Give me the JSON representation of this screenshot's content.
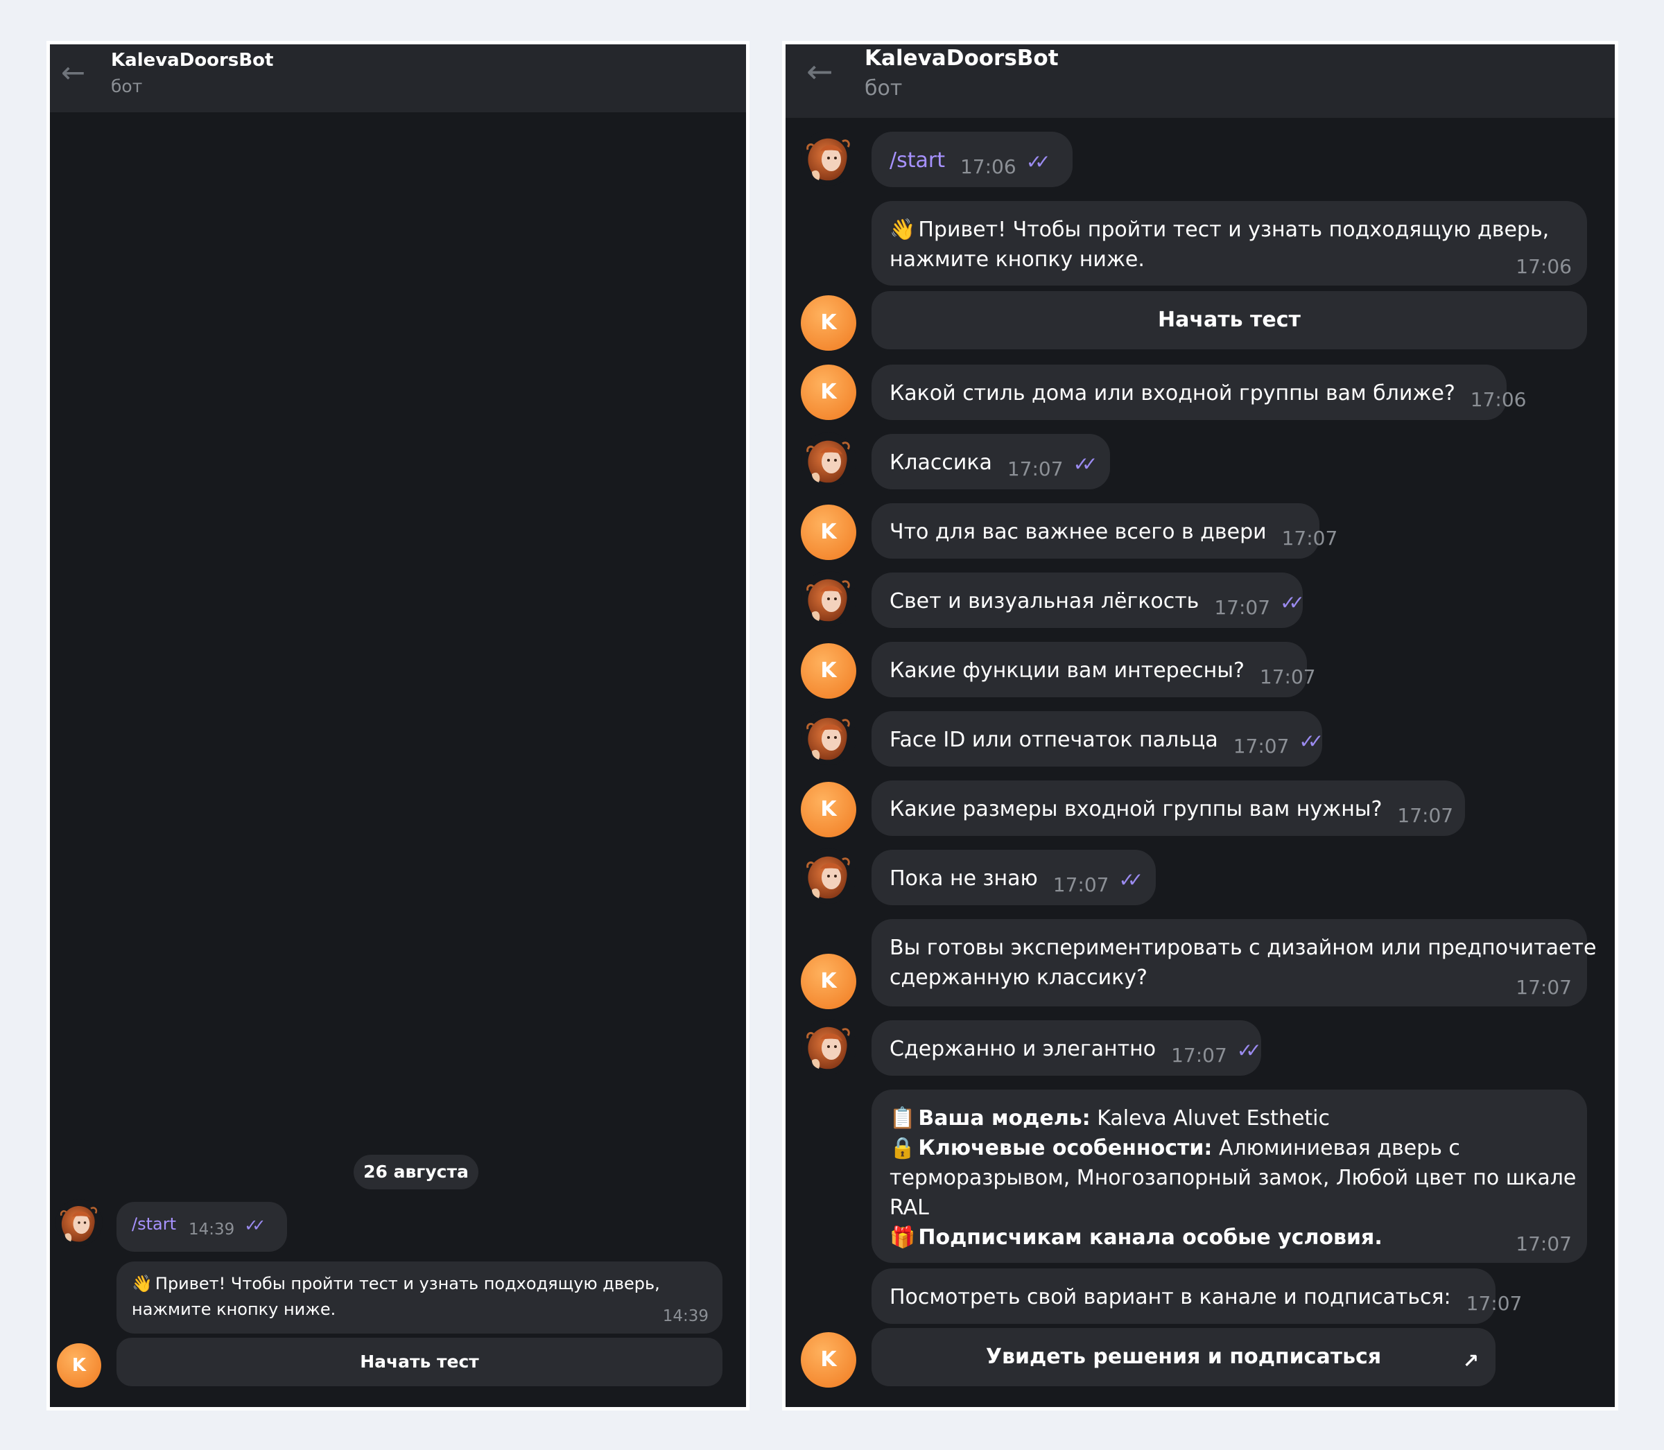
{
  "left": {
    "header": {
      "title": "KalevaDoorsBot",
      "subtitle": "бот"
    },
    "date_separator": "26 августа",
    "user_message": {
      "text": "/start",
      "time": "14:39"
    },
    "bot_message": {
      "line1": "Привет! Чтобы пройти тест и узнать подходящую дверь,",
      "line2": "нажмите кнопку ниже.",
      "time": "14:39"
    },
    "button": "Начать тест",
    "bot_avatar_letter": "K"
  },
  "right": {
    "header": {
      "title": "KalevaDoorsBot",
      "subtitle": "бот"
    },
    "bot_avatar_letter": "K",
    "messages": {
      "m1": {
        "text": "/start",
        "time": "17:06"
      },
      "m2": {
        "line1": "Привет! Чтобы пройти тест и узнать подходящую дверь,",
        "line2": "нажмите кнопку ниже.",
        "time": "17:06"
      },
      "m2_button": "Начать тест",
      "m3": {
        "text": "Какой стиль дома или входной группы вам ближе?",
        "time": "17:06"
      },
      "m4": {
        "text": "Классика",
        "time": "17:07"
      },
      "m5": {
        "text": "Что для вас важнее всего в двери",
        "time": "17:07"
      },
      "m6": {
        "text": "Свет и визуальная лёгкость",
        "time": "17:07"
      },
      "m7": {
        "text": "Какие функции вам интересны?",
        "time": "17:07"
      },
      "m8": {
        "text": "Face ID или отпечаток пальца",
        "time": "17:07"
      },
      "m9": {
        "text": "Какие размеры входной группы вам нужны?",
        "time": "17:07"
      },
      "m10": {
        "text": "Пока не знаю",
        "time": "17:07"
      },
      "m11": {
        "line1": "Вы готовы экспериментировать с дизайном или предпочитаете",
        "line2": "сдержанную классику?",
        "time": "17:07"
      },
      "m12": {
        "text": "Сдержанно и элегантно",
        "time": "17:07"
      },
      "m13": {
        "model_label": "Ваша модель:",
        "model_value": "Kaleva Aluvet Esthetic",
        "features_label": "Ключевые особенности:",
        "features_value_part1": "Алюминиевая дверь с",
        "features_value_part2": "терморазрывом, Многозапорный замок, Любой цвет по шкале",
        "features_value_part3": "RAL",
        "subscribers_note": "Подписчикам канала особые условия.",
        "time": "17:07"
      },
      "m14": {
        "text": "Посмотреть свой вариант в канале и подписаться:",
        "time": "17:07"
      },
      "m14_button": "Увидеть решения и подписаться"
    }
  }
}
